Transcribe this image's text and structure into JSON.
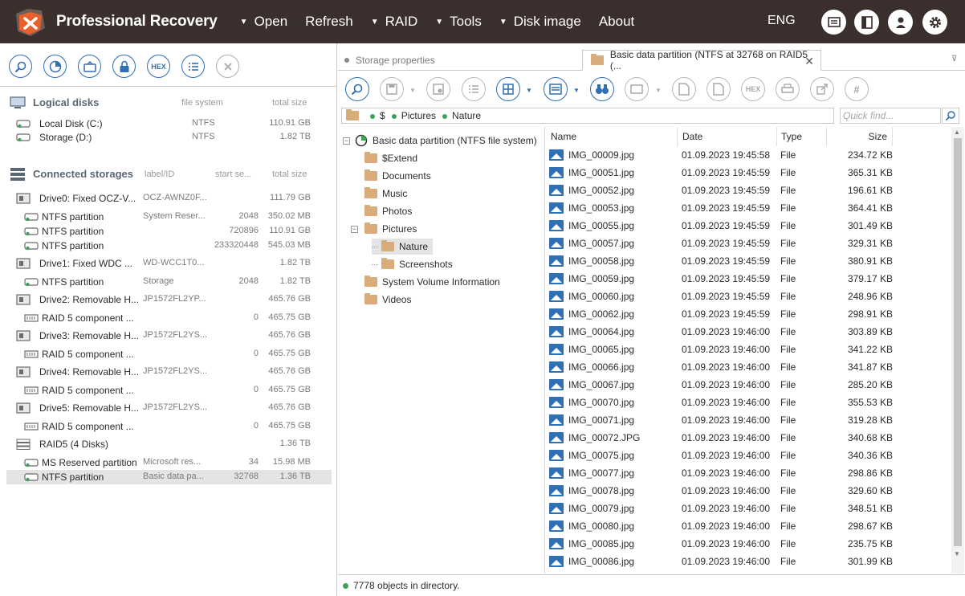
{
  "titlebar": {
    "app_title": "Professional Recovery",
    "menu": [
      {
        "label": "Open",
        "caret": true
      },
      {
        "label": "Refresh",
        "caret": false
      },
      {
        "label": "RAID",
        "caret": true
      },
      {
        "label": "Tools",
        "caret": true
      },
      {
        "label": "Disk image",
        "caret": true
      },
      {
        "label": "About",
        "caret": false
      }
    ],
    "language": "ENG",
    "icons": [
      "messages-icon",
      "sidebar-toggle-icon",
      "user-icon",
      "settings-icon"
    ],
    "colors": {
      "bar": "#3a2f2c",
      "accent": "#e8612c"
    }
  },
  "left": {
    "toolbar_icons": [
      "search-icon",
      "scan-icon",
      "disk-open-icon",
      "lock-icon",
      "hex-icon",
      "list-icon",
      "close-icon"
    ],
    "hex_label": "HEX",
    "logical": {
      "title": "Logical disks",
      "col_fs": "file system",
      "col_size": "total size",
      "rows": [
        {
          "name": "Local Disk (C:)",
          "fs": "NTFS",
          "size": "110.91 GB"
        },
        {
          "name": "Storage (D:)",
          "fs": "NTFS",
          "size": "1.82 TB"
        }
      ]
    },
    "connected": {
      "title": "Connected storages",
      "col_label": "label/ID",
      "col_start": "start se...",
      "col_size": "total size",
      "rows": [
        {
          "name": "Drive0: Fixed OCZ-V...",
          "label": "OCZ-AWNZ0F...",
          "start": "",
          "size": "111.79 GB",
          "icon": "drive-icon",
          "indent": 0
        },
        {
          "name": "NTFS partition",
          "label": "System Reser...",
          "start": "2048",
          "size": "350.02 MB",
          "icon": "partition-icon",
          "indent": 1
        },
        {
          "name": "NTFS partition",
          "label": "",
          "start": "720896",
          "size": "110.91 GB",
          "icon": "partition-icon",
          "indent": 1
        },
        {
          "name": "NTFS partition",
          "label": "",
          "start": "233320448",
          "size": "545.03 MB",
          "icon": "partition-icon",
          "indent": 1
        },
        {
          "name": "Drive1: Fixed WDC ...",
          "label": "WD-WCC1T0...",
          "start": "",
          "size": "1.82 TB",
          "icon": "drive-icon",
          "indent": 0
        },
        {
          "name": "NTFS partition",
          "label": "Storage",
          "start": "2048",
          "size": "1.82 TB",
          "icon": "partition-icon",
          "indent": 1
        },
        {
          "name": "Drive2: Removable H...",
          "label": "JP1572FL2YP...",
          "start": "",
          "size": "465.76 GB",
          "icon": "drive-icon",
          "indent": 0
        },
        {
          "name": "RAID 5 component ...",
          "label": "",
          "start": "0",
          "size": "465.75 GB",
          "icon": "raid-component-icon",
          "indent": 1
        },
        {
          "name": "Drive3: Removable H...",
          "label": "JP1572FL2YS...",
          "start": "",
          "size": "465.76 GB",
          "icon": "drive-icon",
          "indent": 0
        },
        {
          "name": "RAID 5 component ...",
          "label": "",
          "start": "0",
          "size": "465.75 GB",
          "icon": "raid-component-icon",
          "indent": 1
        },
        {
          "name": "Drive4: Removable H...",
          "label": "JP1572FL2YS...",
          "start": "",
          "size": "465.76 GB",
          "icon": "drive-icon",
          "indent": 0
        },
        {
          "name": "RAID 5 component ...",
          "label": "",
          "start": "0",
          "size": "465.75 GB",
          "icon": "raid-component-icon",
          "indent": 1
        },
        {
          "name": "Drive5: Removable H...",
          "label": "JP1572FL2YS...",
          "start": "",
          "size": "465.76 GB",
          "icon": "drive-icon",
          "indent": 0
        },
        {
          "name": "RAID 5 component ...",
          "label": "",
          "start": "0",
          "size": "465.75 GB",
          "icon": "raid-component-icon",
          "indent": 1
        },
        {
          "name": "RAID5 (4 Disks)",
          "label": "",
          "start": "",
          "size": "1.36 TB",
          "icon": "raid-icon",
          "indent": 0
        },
        {
          "name": "MS Reserved partition",
          "label": "Microsoft res...",
          "start": "34",
          "size": "15.98 MB",
          "icon": "partition-icon",
          "indent": 1
        },
        {
          "name": "NTFS partition",
          "label": "Basic data pa...",
          "start": "32768",
          "size": "1.36 TB",
          "icon": "partition-icon",
          "indent": 1,
          "selected": true
        }
      ]
    }
  },
  "right": {
    "tabs": [
      {
        "label": "Storage properties",
        "active": false
      },
      {
        "label": "Basic data partition (NTFS at 32768 on RAID5 (...",
        "active": true
      }
    ],
    "toolbar_icons": [
      "search-icon",
      "save-icon",
      "save-options-icon",
      "checklist-icon",
      "view-mode-icon",
      "panel-icon",
      "binoculars-icon",
      "preview-icon",
      "file-properties-icon",
      "file-icon",
      "hex-icon",
      "print-icon",
      "export-icon",
      "hash-icon"
    ],
    "hex_label": "HEX",
    "path": [
      "$",
      "Pictures",
      "Nature"
    ],
    "find_placeholder": "Quick find...",
    "tree": [
      {
        "label": "Basic data partition (NTFS file system)",
        "level": 0,
        "expander": "minus",
        "icon": "partition-root-icon"
      },
      {
        "label": "$Extend",
        "level": 1,
        "expander": "plus",
        "icon": "folder-icon"
      },
      {
        "label": "Documents",
        "level": 1,
        "expander": "plus",
        "icon": "folder-icon"
      },
      {
        "label": "Music",
        "level": 1,
        "expander": "plus",
        "icon": "folder-icon"
      },
      {
        "label": "Photos",
        "level": 1,
        "expander": "plus",
        "icon": "folder-icon"
      },
      {
        "label": "Pictures",
        "level": 1,
        "expander": "minus",
        "icon": "folder-icon"
      },
      {
        "label": "Nature",
        "level": 2,
        "expander": "",
        "icon": "folder-icon",
        "selected": true
      },
      {
        "label": "Screenshots",
        "level": 2,
        "expander": "",
        "icon": "folder-icon"
      },
      {
        "label": "System Volume Information",
        "level": 1,
        "expander": "plus",
        "icon": "folder-icon"
      },
      {
        "label": "Videos",
        "level": 1,
        "expander": "plus",
        "icon": "folder-icon"
      }
    ],
    "columns": [
      "Name",
      "Date",
      "Type",
      "Size"
    ],
    "files": [
      {
        "name": "IMG_00009.jpg",
        "date": "01.09.2023 19:45:58",
        "type": "File",
        "size": "234.72 KB"
      },
      {
        "name": "IMG_00051.jpg",
        "date": "01.09.2023 19:45:59",
        "type": "File",
        "size": "365.31 KB"
      },
      {
        "name": "IMG_00052.jpg",
        "date": "01.09.2023 19:45:59",
        "type": "File",
        "size": "196.61 KB"
      },
      {
        "name": "IMG_00053.jpg",
        "date": "01.09.2023 19:45:59",
        "type": "File",
        "size": "364.41 KB"
      },
      {
        "name": "IMG_00055.jpg",
        "date": "01.09.2023 19:45:59",
        "type": "File",
        "size": "301.49 KB"
      },
      {
        "name": "IMG_00057.jpg",
        "date": "01.09.2023 19:45:59",
        "type": "File",
        "size": "329.31 KB"
      },
      {
        "name": "IMG_00058.jpg",
        "date": "01.09.2023 19:45:59",
        "type": "File",
        "size": "380.91 KB"
      },
      {
        "name": "IMG_00059.jpg",
        "date": "01.09.2023 19:45:59",
        "type": "File",
        "size": "379.17 KB"
      },
      {
        "name": "IMG_00060.jpg",
        "date": "01.09.2023 19:45:59",
        "type": "File",
        "size": "248.96 KB"
      },
      {
        "name": "IMG_00062.jpg",
        "date": "01.09.2023 19:45:59",
        "type": "File",
        "size": "298.91 KB"
      },
      {
        "name": "IMG_00064.jpg",
        "date": "01.09.2023 19:46:00",
        "type": "File",
        "size": "303.89 KB"
      },
      {
        "name": "IMG_00065.jpg",
        "date": "01.09.2023 19:46:00",
        "type": "File",
        "size": "341.22 KB"
      },
      {
        "name": "IMG_00066.jpg",
        "date": "01.09.2023 19:46:00",
        "type": "File",
        "size": "341.87 KB"
      },
      {
        "name": "IMG_00067.jpg",
        "date": "01.09.2023 19:46:00",
        "type": "File",
        "size": "285.20 KB"
      },
      {
        "name": "IMG_00070.jpg",
        "date": "01.09.2023 19:46:00",
        "type": "File",
        "size": "355.53 KB"
      },
      {
        "name": "IMG_00071.jpg",
        "date": "01.09.2023 19:46:00",
        "type": "File",
        "size": "319.28 KB"
      },
      {
        "name": "IMG_00072.JPG",
        "date": "01.09.2023 19:46:00",
        "type": "File",
        "size": "340.68 KB"
      },
      {
        "name": "IMG_00075.jpg",
        "date": "01.09.2023 19:46:00",
        "type": "File",
        "size": "340.36 KB"
      },
      {
        "name": "IMG_00077.jpg",
        "date": "01.09.2023 19:46:00",
        "type": "File",
        "size": "298.86 KB"
      },
      {
        "name": "IMG_00078.jpg",
        "date": "01.09.2023 19:46:00",
        "type": "File",
        "size": "329.60 KB"
      },
      {
        "name": "IMG_00079.jpg",
        "date": "01.09.2023 19:46:00",
        "type": "File",
        "size": "348.51 KB"
      },
      {
        "name": "IMG_00080.jpg",
        "date": "01.09.2023 19:46:00",
        "type": "File",
        "size": "298.67 KB"
      },
      {
        "name": "IMG_00085.jpg",
        "date": "01.09.2023 19:46:00",
        "type": "File",
        "size": "235.75 KB"
      },
      {
        "name": "IMG_00086.jpg",
        "date": "01.09.2023 19:46:00",
        "type": "File",
        "size": "301.99 KB"
      }
    ],
    "status_text": "7778 objects in directory."
  }
}
